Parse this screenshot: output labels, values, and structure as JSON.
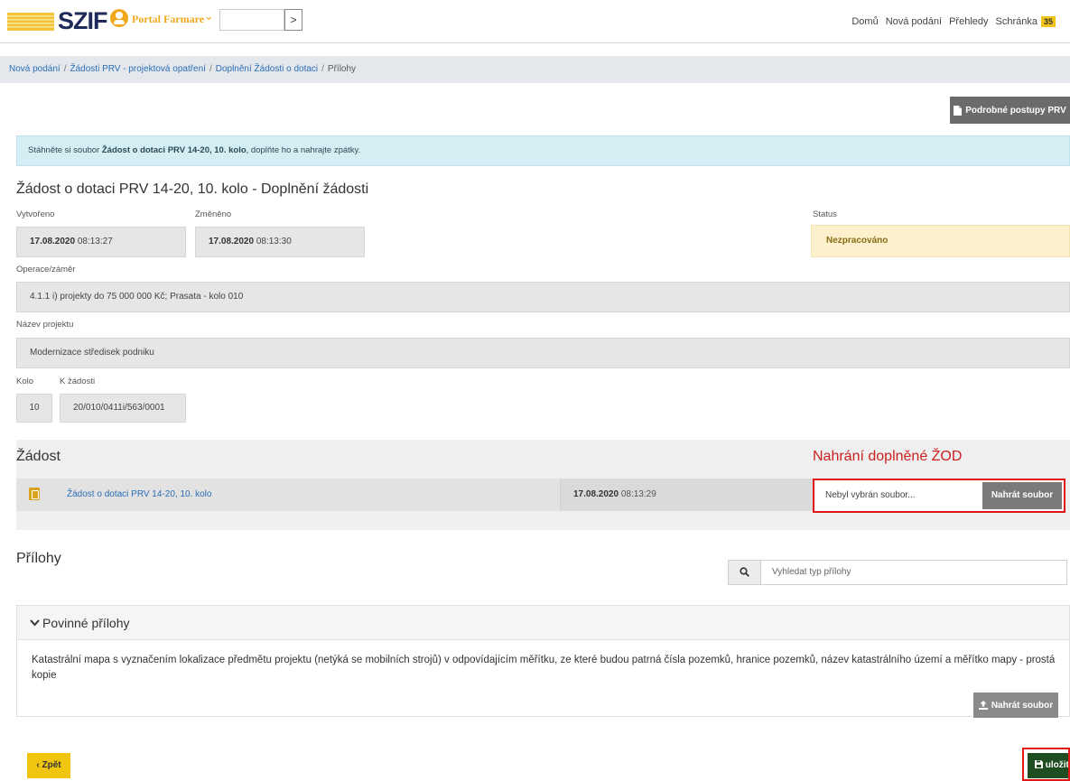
{
  "header": {
    "logo_text": "SZIF",
    "portal_label": "Portal Farmare",
    "portal_chevron": "⌄",
    "go_button": ">",
    "nav": [
      {
        "label": "Domů"
      },
      {
        "label": "Nová podání"
      },
      {
        "label": "Přehledy"
      },
      {
        "label": "Schránka"
      }
    ],
    "inbox_badge": "35"
  },
  "breadcrumb": {
    "items": [
      "Nová podání",
      "Žádosti PRV - projektová opatření",
      "Doplnění Žádosti o dotaci"
    ],
    "current": "Přílohy",
    "separator": "/"
  },
  "procedures_button": "Podrobné postupy PRV",
  "info": {
    "prefix": "Stáhněte si soubor ",
    "file": "Žádost o dotaci PRV 14-20, 10. kolo",
    "suffix": ", doplňte ho a nahrajte zpátky."
  },
  "form": {
    "title": "Žádost o dotaci PRV 14-20, 10. kolo - Doplnění žádosti",
    "created_label": "Vytvořeno",
    "created_date": "17.08.2020",
    "created_time": "08:13:27",
    "changed_label": "Změněno",
    "changed_date": "17.08.2020",
    "changed_time": "08:13:30",
    "status_label": "Status",
    "status_value": "Nezpracováno",
    "operation_label": "Operace/záměr",
    "operation_value": "4.1.1 i) projekty do 75 000 000 Kč; Prasata - kolo 010",
    "project_name_label": "Název projektu",
    "project_name_value": "Modernizace středisek podniku",
    "round_label": "Kolo",
    "round_value": "10",
    "ref_label": "K žádosti",
    "ref_value": "20/010/0411i/563/0001"
  },
  "zadost": {
    "title": "Žádost",
    "upload_heading": "Nahrání doplněné ŽOD",
    "file_link": "Žádost o dotaci PRV 14-20, 10. kolo",
    "file_date": "17.08.2020",
    "file_time": "08:13:29",
    "no_file": "Nebyl vybrán soubor...",
    "upload_button": "Nahrát soubor"
  },
  "prilohy": {
    "title": "Přílohy",
    "search_placeholder": "Vyhledat typ přílohy",
    "panel_title": "Povinné přílohy",
    "item_text": "Katastrální mapa s vyznačením lokalizace předmětu projektu (netýká se mobilních strojů) v odpovídajícím měřítku, ze které budou patrná čísla pozemků, hranice pozemků, název katastrálního území a měřítko mapy - prostá kopie",
    "upload_button": "Nahrát soubor"
  },
  "footer": {
    "back_button": "Zpět",
    "back_chevron": "‹",
    "save_button": "uložit"
  },
  "colors": {
    "brand_navy": "#1d2a5a",
    "brand_yellow": "#f0a81c",
    "link": "#2a6eb8",
    "highlight_red": "#e01515",
    "save_green": "#1e4d22",
    "back_yellow": "#f1c40f"
  },
  "icons": {
    "portal": "user-circle-icon",
    "procedures": "document-icon",
    "file": "pdf-icon",
    "search": "search-icon",
    "upload": "upload-icon",
    "collapse": "chevron-down-icon",
    "save": "floppy-disk-icon"
  }
}
